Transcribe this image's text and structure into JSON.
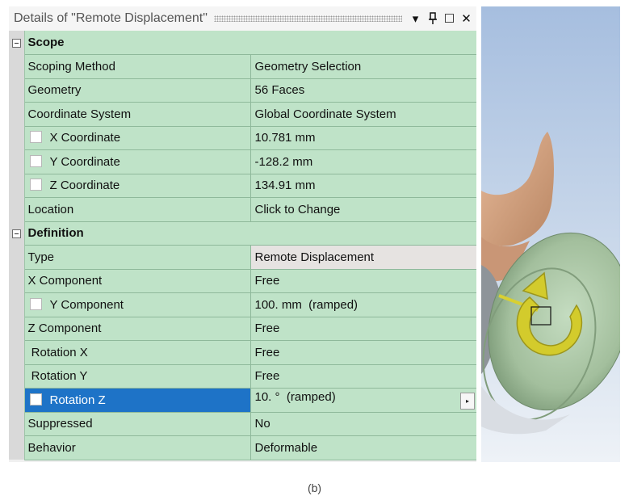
{
  "panel": {
    "title": "Details of \"Remote Displacement\"",
    "buttons": {
      "dropdown": "▾",
      "pin": "ᵰ",
      "maximize": "☐",
      "close": "✕"
    }
  },
  "groups": [
    {
      "title": "Scope",
      "rows": [
        {
          "name": "Scoping Method",
          "value": "Geometry Selection"
        },
        {
          "name": "Geometry",
          "value": "56 Faces"
        },
        {
          "name": "Coordinate System",
          "value": "Global Coordinate System"
        },
        {
          "name": "X Coordinate",
          "value": "10.781 mm",
          "checkbox": true
        },
        {
          "name": "Y Coordinate",
          "value": "-128.2 mm",
          "checkbox": true
        },
        {
          "name": "Z Coordinate",
          "value": "134.91 mm",
          "checkbox": true
        },
        {
          "name": "Location",
          "value": "Click to Change"
        }
      ]
    },
    {
      "title": "Definition",
      "rows": [
        {
          "name": "Type",
          "value": "Remote Displacement",
          "value_grey": true
        },
        {
          "name": "X Component",
          "value": "Free"
        },
        {
          "name": "Y Component",
          "value": "100. mm  (ramped)",
          "checkbox": true
        },
        {
          "name": "Z Component",
          "value": "Free"
        },
        {
          "name": " Rotation X",
          "value": "Free"
        },
        {
          "name": " Rotation Y",
          "value": "Free"
        },
        {
          "name": "Rotation Z",
          "value": "10. °  (ramped)",
          "checkbox": true,
          "selected": true,
          "dropdown": true
        },
        {
          "name": "Suppressed",
          "value": "No"
        },
        {
          "name": "Behavior",
          "value": "Deformable"
        }
      ]
    }
  ],
  "caption": "(b)",
  "colors": {
    "row_bg": "#bfe3c8",
    "selected": "#1e73c7",
    "model": "#a9c4a3",
    "arrow": "#d8d032"
  }
}
